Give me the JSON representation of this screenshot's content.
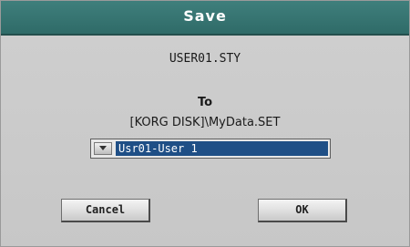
{
  "dialog": {
    "title": "Save",
    "filename": "USER01.STY",
    "to_label": "To",
    "path": "[KORG DISK]\\MyData.SET",
    "destination": {
      "selected": "Usr01-User 1",
      "icon": "chevron-down-icon"
    },
    "buttons": {
      "cancel": "Cancel",
      "ok": "OK"
    }
  },
  "colors": {
    "title_bar": "#2f6b68",
    "selection": "#1f4f86",
    "background": "#c9c9c9"
  }
}
